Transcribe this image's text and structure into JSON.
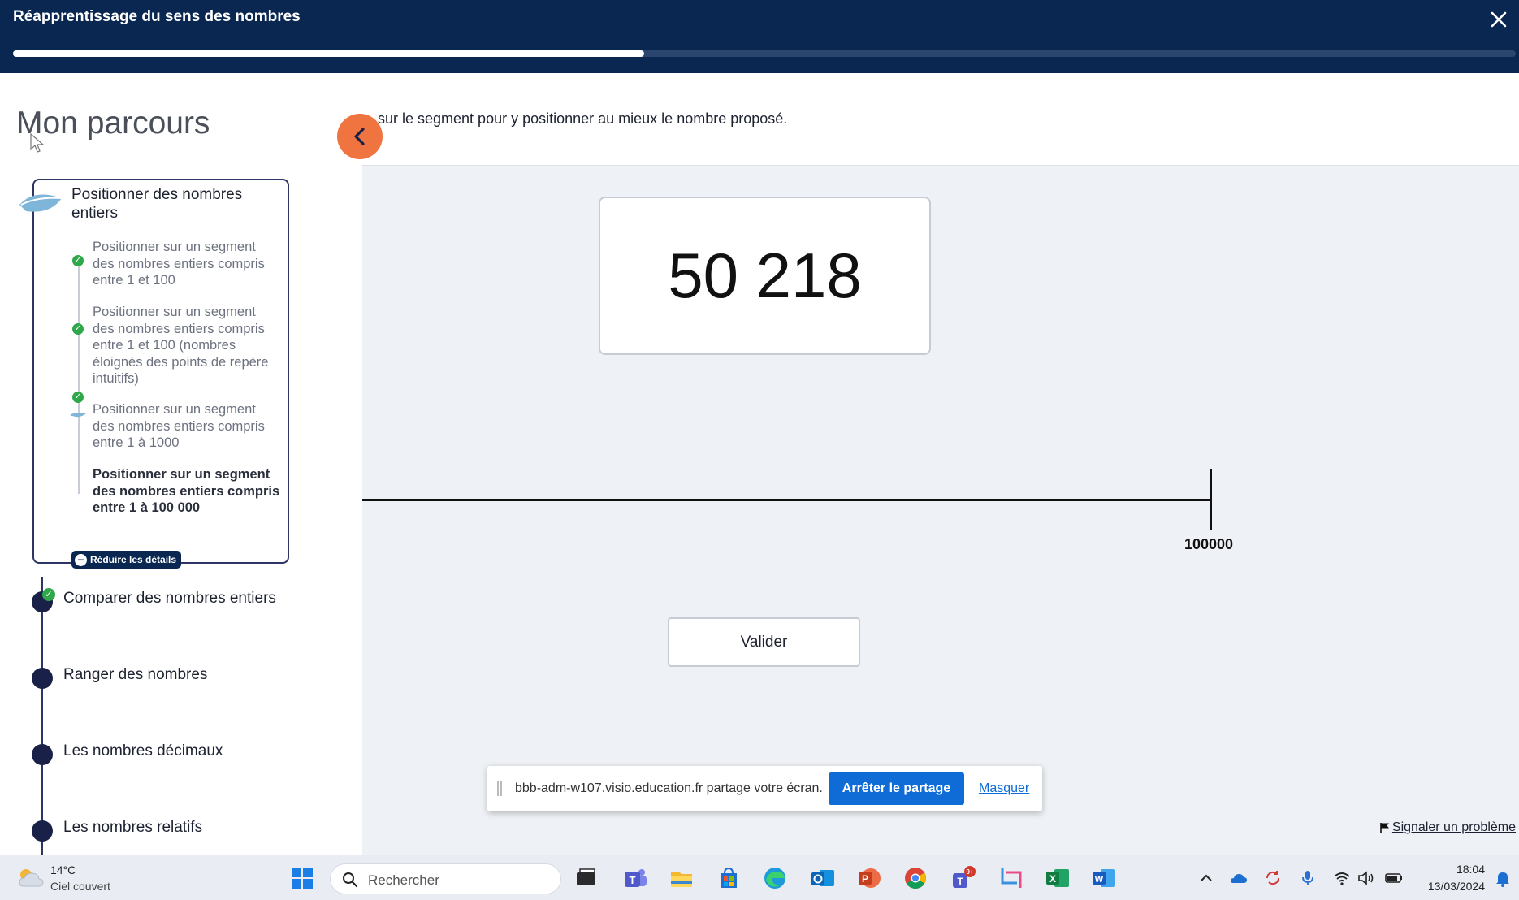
{
  "header": {
    "title": "Réapprentissage du sens des nombres",
    "close_icon": "close-icon",
    "progress_fraction": 0.42
  },
  "sidebar": {
    "title": "Mon parcours",
    "current_step": {
      "title": "Positionner des nombres entiers",
      "substeps": [
        {
          "label": "Positionner sur un segment des nombres entiers compris entre 1 et 100",
          "status": "done"
        },
        {
          "label": "Positionner sur un segment des nombres entiers compris entre 1 et 100 (nombres éloignés des points de repère intuitifs)",
          "status": "done"
        },
        {
          "label": "Positionner sur un segment des nombres entiers compris entre 1 à 1000",
          "status": "done"
        },
        {
          "label": "Positionner sur un segment des nombres entiers compris entre 1 à 100 000",
          "status": "active"
        }
      ],
      "reduce_label": "Réduire les détails"
    },
    "steps": [
      {
        "label": "Comparer des nombres entiers",
        "status": "done"
      },
      {
        "label": "Ranger des nombres",
        "status": "todo"
      },
      {
        "label": "Les nombres décimaux",
        "status": "todo"
      },
      {
        "label": "Les nombres relatifs",
        "status": "todo"
      }
    ]
  },
  "main": {
    "instruction": "sur le segment pour y positionner au mieux le nombre proposé.",
    "target_number": "50 218",
    "number_line_end_label": "100000",
    "validate_label": "Valider",
    "report_label": "Signaler un problème"
  },
  "share_banner": {
    "text": "bbb-adm-w107.visio.education.fr partage votre écran.",
    "stop_label": "Arrêter le partage",
    "hide_label": "Masquer"
  },
  "taskbar": {
    "weather_temp": "14°C",
    "weather_desc": "Ciel couvert",
    "search_placeholder": "Rechercher",
    "time": "18:04",
    "date": "13/03/2024",
    "teams_badge": "9+"
  },
  "colors": {
    "header_bg": "#0a2752",
    "accent_orange": "#f0743f",
    "success_green": "#2ea84b",
    "share_blue": "#0f6cd6"
  }
}
